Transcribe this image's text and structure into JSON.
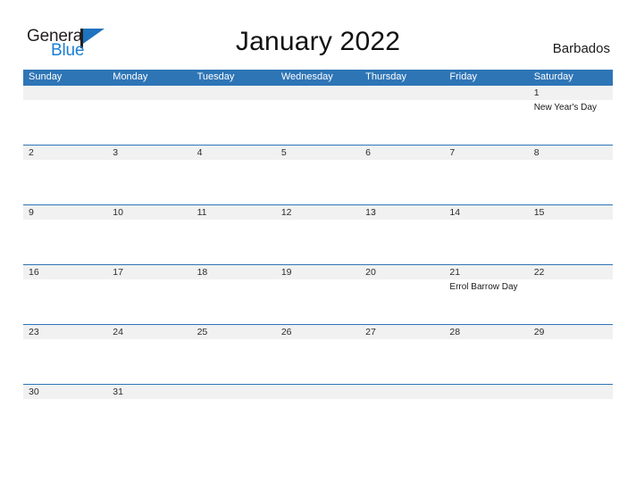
{
  "brand": {
    "logo_text_top": "General",
    "logo_text_bottom": "Blue",
    "logo_color_primary": "#1e73be",
    "logo_color_dark": "#231f20"
  },
  "header": {
    "title": "January 2022",
    "country": "Barbados",
    "header_bg_color": "#2e75b6",
    "row_band_color": "#f1f1f1"
  },
  "calendar": {
    "month": "January",
    "year": "2022",
    "weekday_headers": [
      "Sunday",
      "Monday",
      "Tuesday",
      "Wednesday",
      "Thursday",
      "Friday",
      "Saturday"
    ],
    "weeks": [
      {
        "days": [
          {
            "number": "",
            "event": ""
          },
          {
            "number": "",
            "event": ""
          },
          {
            "number": "",
            "event": ""
          },
          {
            "number": "",
            "event": ""
          },
          {
            "number": "",
            "event": ""
          },
          {
            "number": "",
            "event": ""
          },
          {
            "number": "1",
            "event": "New Year's Day"
          }
        ]
      },
      {
        "days": [
          {
            "number": "2",
            "event": ""
          },
          {
            "number": "3",
            "event": ""
          },
          {
            "number": "4",
            "event": ""
          },
          {
            "number": "5",
            "event": ""
          },
          {
            "number": "6",
            "event": ""
          },
          {
            "number": "7",
            "event": ""
          },
          {
            "number": "8",
            "event": ""
          }
        ]
      },
      {
        "days": [
          {
            "number": "9",
            "event": ""
          },
          {
            "number": "10",
            "event": ""
          },
          {
            "number": "11",
            "event": ""
          },
          {
            "number": "12",
            "event": ""
          },
          {
            "number": "13",
            "event": ""
          },
          {
            "number": "14",
            "event": ""
          },
          {
            "number": "15",
            "event": ""
          }
        ]
      },
      {
        "days": [
          {
            "number": "16",
            "event": ""
          },
          {
            "number": "17",
            "event": ""
          },
          {
            "number": "18",
            "event": ""
          },
          {
            "number": "19",
            "event": ""
          },
          {
            "number": "20",
            "event": ""
          },
          {
            "number": "21",
            "event": "Errol Barrow Day"
          },
          {
            "number": "22",
            "event": ""
          }
        ]
      },
      {
        "days": [
          {
            "number": "23",
            "event": ""
          },
          {
            "number": "24",
            "event": ""
          },
          {
            "number": "25",
            "event": ""
          },
          {
            "number": "26",
            "event": ""
          },
          {
            "number": "27",
            "event": ""
          },
          {
            "number": "28",
            "event": ""
          },
          {
            "number": "29",
            "event": ""
          }
        ]
      },
      {
        "days": [
          {
            "number": "30",
            "event": ""
          },
          {
            "number": "31",
            "event": ""
          },
          {
            "number": "",
            "event": ""
          },
          {
            "number": "",
            "event": ""
          },
          {
            "number": "",
            "event": ""
          },
          {
            "number": "",
            "event": ""
          },
          {
            "number": "",
            "event": ""
          }
        ]
      }
    ]
  }
}
